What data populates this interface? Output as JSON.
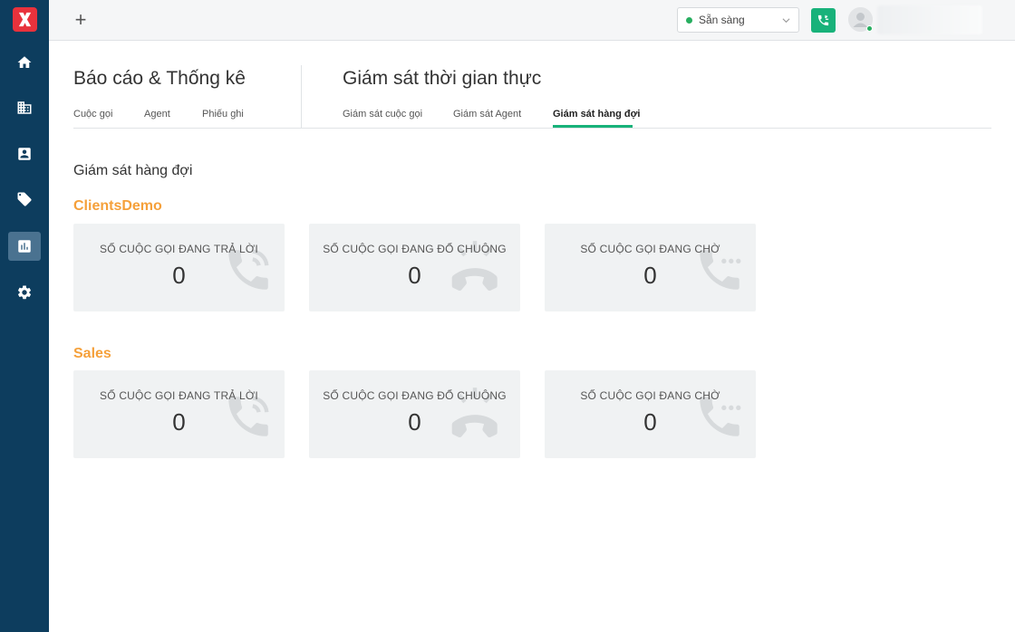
{
  "sidebar": {
    "logo": "x-logo-icon",
    "items": [
      {
        "icon": "home-icon",
        "active": false
      },
      {
        "icon": "building-icon",
        "active": false
      },
      {
        "icon": "contact-card-icon",
        "active": false
      },
      {
        "icon": "tag-icon",
        "active": false
      },
      {
        "icon": "report-chart-icon",
        "active": true
      },
      {
        "icon": "gear-icon",
        "active": false
      }
    ]
  },
  "topbar": {
    "add_symbol": "+",
    "status": {
      "label": "Sẵn sàng",
      "color": "#27ae60"
    },
    "call_button_color": "#18b27a"
  },
  "reports": {
    "title": "Báo cáo & Thống kê",
    "tabs": [
      "Cuộc gọi",
      "Agent",
      "Phiếu ghi"
    ]
  },
  "realtime": {
    "title": "Giám sát thời gian thực",
    "tabs": [
      "Giám sát cuộc gọi",
      "Giám sát Agent",
      "Giám sát hàng đợi"
    ],
    "active_tab": "Giám sát hàng đợi"
  },
  "page": {
    "subtitle": "Giám sát hàng đợi"
  },
  "queues": [
    {
      "name": "ClientsDemo",
      "cards": [
        {
          "label": "SỐ CUỘC GỌI ĐANG TRẢ LỜI",
          "value": "0",
          "icon": "phone-in-talk-icon"
        },
        {
          "label": "SỐ CUỘC GỌI ĐANG ĐỔ CHUÔNG",
          "value": "0",
          "icon": "phone-ringing-icon"
        },
        {
          "label": "SỐ CUỘC GỌI ĐANG CHỜ",
          "value": "0",
          "icon": "phone-waiting-icon"
        }
      ]
    },
    {
      "name": "Sales",
      "cards": [
        {
          "label": "SỐ CUỘC GỌI ĐANG TRẢ LỜI",
          "value": "0",
          "icon": "phone-in-talk-icon"
        },
        {
          "label": "SỐ CUỘC GỌI ĐANG ĐỔ CHUÔNG",
          "value": "0",
          "icon": "phone-ringing-icon"
        },
        {
          "label": "SỐ CUỘC GỌI ĐANG CHỜ",
          "value": "0",
          "icon": "phone-waiting-icon"
        }
      ]
    }
  ],
  "colors": {
    "sidebar_bg": "#0d3d5e",
    "accent": "#18b27a",
    "queue_name": "#f5a03a",
    "card_bg": "#f0f2f3"
  }
}
